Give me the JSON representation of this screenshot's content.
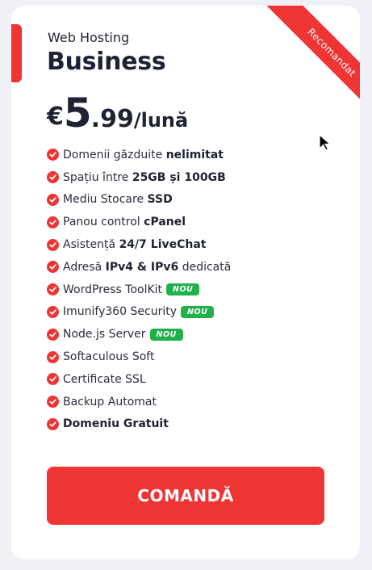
{
  "plan": {
    "ribbon": "Recomandat",
    "subtitle": "Web Hosting",
    "title": "Business",
    "price": {
      "currency": "€",
      "integer": "5",
      "decimal": ".99",
      "period": "/lună"
    }
  },
  "features": [
    {
      "pre": "Domenii găzduite ",
      "bold": "nelimitat",
      "post": "",
      "badge": ""
    },
    {
      "pre": "Spațiu între ",
      "bold": "25GB și 100GB",
      "post": "",
      "badge": ""
    },
    {
      "pre": "Mediu Stocare ",
      "bold": "SSD",
      "post": "",
      "badge": ""
    },
    {
      "pre": "Panou control ",
      "bold": "cPanel",
      "post": "",
      "badge": ""
    },
    {
      "pre": "Asistență ",
      "bold": "24/7 LiveChat",
      "post": "",
      "badge": ""
    },
    {
      "pre": "Adresă ",
      "bold": "IPv4 & IPv6",
      "post": " dedicată",
      "badge": ""
    },
    {
      "pre": "WordPress ToolKit",
      "bold": "",
      "post": "",
      "badge": "NOU"
    },
    {
      "pre": "Imunify360 Security",
      "bold": "",
      "post": "",
      "badge": "NOU"
    },
    {
      "pre": "Node.js Server",
      "bold": "",
      "post": "",
      "badge": "NOU"
    },
    {
      "pre": "Softaculous Soft",
      "bold": "",
      "post": "",
      "badge": ""
    },
    {
      "pre": "Certificate SSL",
      "bold": "",
      "post": "",
      "badge": ""
    },
    {
      "pre": "Backup Automat",
      "bold": "",
      "post": "",
      "badge": ""
    },
    {
      "pre": "",
      "bold": "Domeniu Gratuit",
      "post": "",
      "badge": ""
    }
  ],
  "actions": {
    "order_label": "COMANDĂ"
  },
  "colors": {
    "accent": "#ef3434",
    "badge": "#22b04b",
    "text": "#1f2233"
  }
}
